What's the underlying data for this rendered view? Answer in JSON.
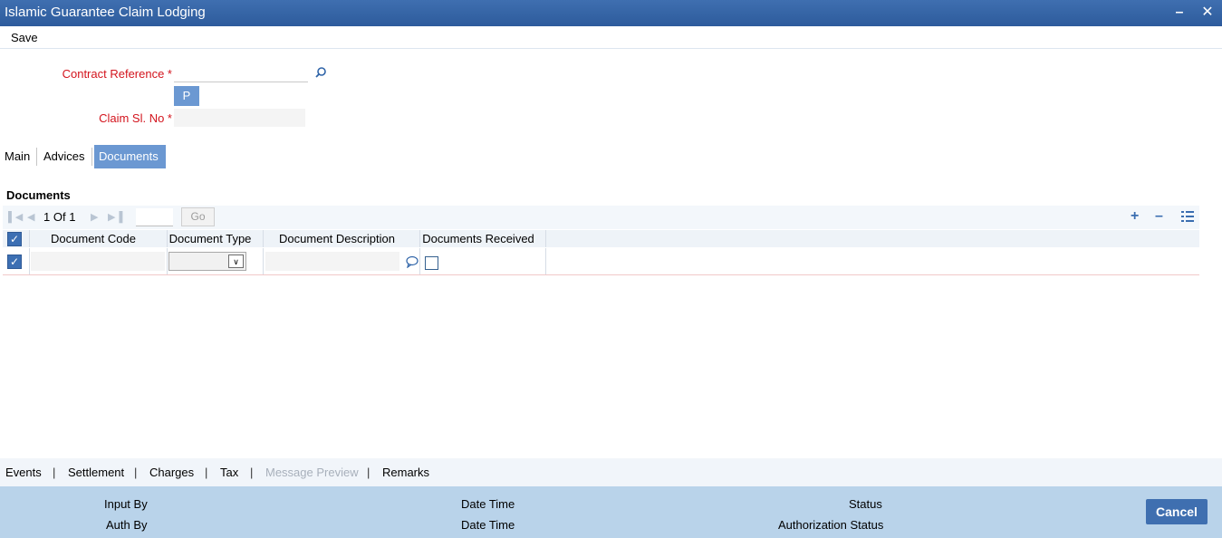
{
  "window": {
    "title": "Islamic Guarantee Claim Lodging"
  },
  "menu": {
    "save_label": "Save"
  },
  "form": {
    "contract_reference_label": "Contract Reference *",
    "contract_reference_value": "",
    "p_button_label": "P",
    "claim_sl_no_label": "Claim Sl. No *",
    "claim_sl_no_value": ""
  },
  "tabs": [
    {
      "label": "Main",
      "active": false
    },
    {
      "label": "Advices",
      "active": false
    },
    {
      "label": "Documents",
      "active": true
    }
  ],
  "documents": {
    "title": "Documents",
    "pager": {
      "current": "1",
      "of_label": "Of",
      "total": "1",
      "go_label": "Go"
    },
    "columns": [
      "Document Code",
      "Document Type",
      "Document Description",
      "Documents Received"
    ],
    "rows": [
      {
        "checked": true,
        "document_code": "",
        "document_type": "",
        "document_description": "",
        "documents_received": false
      }
    ]
  },
  "footer_links": [
    {
      "label": "Events",
      "enabled": true
    },
    {
      "label": "Settlement",
      "enabled": true
    },
    {
      "label": "Charges",
      "enabled": true
    },
    {
      "label": "Tax",
      "enabled": true
    },
    {
      "label": "Message Preview",
      "enabled": false
    },
    {
      "label": "Remarks",
      "enabled": true
    }
  ],
  "audit": {
    "input_by_label": "Input By",
    "auth_by_label": "Auth By",
    "date_time_label_1": "Date Time",
    "date_time_label_2": "Date Time",
    "status_label": "Status",
    "authorization_status_label": "Authorization Status",
    "cancel_label": "Cancel"
  },
  "colors": {
    "title_bar": "#2d5b9c",
    "accent": "#6b98d2",
    "required": "#d3141d",
    "audit_bar": "#b9d3ea"
  },
  "icons": [
    "minimize-icon",
    "close-icon",
    "search-icon",
    "first-page-icon",
    "prev-page-icon",
    "next-page-icon",
    "last-page-icon",
    "add-row-icon",
    "delete-row-icon",
    "view-single-row-icon",
    "dropdown-arrow-icon",
    "comment-icon"
  ]
}
